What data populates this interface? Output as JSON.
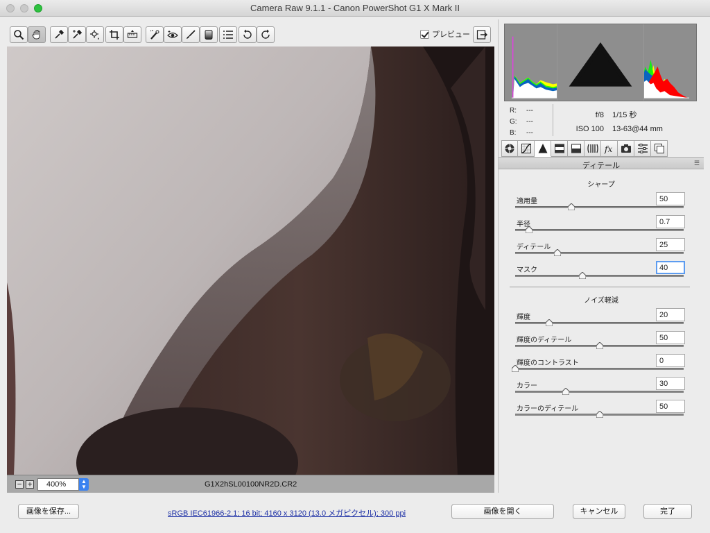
{
  "window": {
    "title": "Camera Raw 9.1.1  -  Canon PowerShot G1 X Mark II"
  },
  "toolbar": {
    "preview_label": "プレビュー",
    "tools": [
      {
        "name": "zoom-tool",
        "icon": "magnifier-icon"
      },
      {
        "name": "hand-tool",
        "icon": "hand-icon"
      },
      {
        "name": "white-balance-tool",
        "icon": "eyedropper-icon"
      },
      {
        "name": "color-sampler-tool",
        "icon": "color-sampler-icon"
      },
      {
        "name": "targeted-adjustment-tool",
        "icon": "target-adjust-icon"
      },
      {
        "name": "crop-tool",
        "icon": "crop-icon"
      },
      {
        "name": "straighten-tool",
        "icon": "level-icon"
      },
      {
        "name": "spot-removal-tool",
        "icon": "brush-heal-icon"
      },
      {
        "name": "red-eye-tool",
        "icon": "eye-icon"
      },
      {
        "name": "adjustment-brush-tool",
        "icon": "brush-icon"
      },
      {
        "name": "graduated-filter-tool",
        "icon": "gradient-icon"
      },
      {
        "name": "preferences-tool",
        "icon": "list-icon"
      },
      {
        "name": "rotate-ccw-tool",
        "icon": "rotate-left-icon"
      },
      {
        "name": "rotate-cw-tool",
        "icon": "rotate-right-icon"
      }
    ]
  },
  "statusbar": {
    "zoom": "400%",
    "filename": "G1X2hSL00100NR2D.CR2"
  },
  "info": {
    "r_label": "R:",
    "r_value": "---",
    "g_label": "G:",
    "g_value": "---",
    "b_label": "B:",
    "b_value": "---",
    "aperture": "f/8",
    "shutter": "1/15 秒",
    "iso": "ISO 100",
    "lens": "13-63@44 mm"
  },
  "panel": {
    "title": "ディテール",
    "sharpen_title": "シャープ",
    "noise_title": "ノイズ軽減",
    "sliders_sharpen": [
      {
        "label": "適用量",
        "value": "50",
        "level": 0.333
      },
      {
        "label": "半径",
        "value": "0.7",
        "level": 0.083
      },
      {
        "label": "ディテール",
        "value": "25",
        "level": 0.25
      },
      {
        "label": "マスク",
        "value": "40",
        "level": 0.4
      }
    ],
    "sliders_noise": [
      {
        "label": "輝度",
        "value": "20",
        "level": 0.2
      },
      {
        "label": "輝度のディテール",
        "value": "50",
        "level": 0.5
      },
      {
        "label": "輝度のコントラスト",
        "value": "0",
        "level": 0.0
      },
      {
        "label": "カラー",
        "value": "30",
        "level": 0.3
      },
      {
        "label": "カラーのディテール",
        "value": "50",
        "level": 0.5
      }
    ]
  },
  "bottom": {
    "save_label": "画像を保存...",
    "workflow_text": "sRGB IEC61966-2.1; 16 bit; 4160 x 3120 (13.0 メガピクセル); 300 ppi",
    "open_label": "画像を開く",
    "cancel_label": "キャンセル",
    "done_label": "完了"
  }
}
